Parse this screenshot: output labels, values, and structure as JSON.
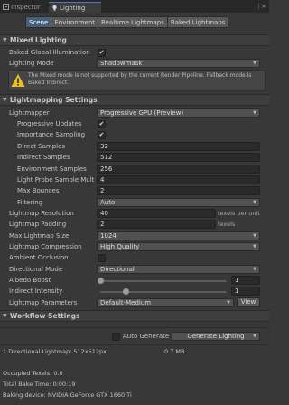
{
  "window_tabs": [
    {
      "label": "Inspector",
      "icon": "inspector-icon",
      "active": false
    },
    {
      "label": "Lighting",
      "icon": "lighting-icon",
      "active": true
    }
  ],
  "lighting_tabs": [
    "Scene",
    "Environment",
    "Realtime Lightmaps",
    "Baked Lightmaps"
  ],
  "sections": {
    "mixed": "Mixed Lighting",
    "lightmapping": "Lightmapping Settings",
    "workflow": "Workflow Settings"
  },
  "mixed": {
    "baked_gi_label": "Baked Global Illumination",
    "baked_gi_checked": true,
    "lighting_mode_label": "Lighting Mode",
    "lighting_mode_value": "Shadowmask",
    "warning_text": "The Mixed mode is not supported by the current Render Pipeline. Fallback mode is Baked Indirect."
  },
  "lightmapping": {
    "lightmapper_label": "Lightmapper",
    "lightmapper_value": "Progressive GPU (Preview)",
    "progressive_updates_label": "Progressive Updates",
    "progressive_updates_checked": true,
    "importance_sampling_label": "Importance Sampling",
    "importance_sampling_checked": true,
    "direct_samples_label": "Direct Samples",
    "direct_samples_value": "32",
    "indirect_samples_label": "Indirect Samples",
    "indirect_samples_value": "512",
    "environment_samples_label": "Environment Samples",
    "environment_samples_value": "256",
    "light_probe_label": "Light Probe Sample Multi",
    "light_probe_value": "4",
    "max_bounces_label": "Max Bounces",
    "max_bounces_value": "2",
    "filtering_label": "Filtering",
    "filtering_value": "Auto",
    "resolution_label": "Lightmap Resolution",
    "resolution_value": "40",
    "resolution_unit": "texels per unit",
    "padding_label": "Lightmap Padding",
    "padding_value": "2",
    "padding_unit": "texels",
    "max_size_label": "Max Lightmap Size",
    "max_size_value": "1024",
    "compression_label": "Lightmap Compression",
    "compression_value": "High Quality",
    "ambient_occlusion_label": "Ambient Occlusion",
    "ambient_occlusion_checked": false,
    "directional_mode_label": "Directional Mode",
    "directional_mode_value": "Directional",
    "albedo_boost_label": "Albedo Boost",
    "albedo_boost_value": "1",
    "albedo_boost_fraction": 0.0,
    "indirect_intensity_label": "Indirect Intensity",
    "indirect_intensity_value": "1",
    "indirect_intensity_fraction": 0.2,
    "parameters_label": "Lightmap Parameters",
    "parameters_value": "Default-Medium",
    "view_button": "View"
  },
  "workflow": {
    "auto_generate_label": "Auto Generate",
    "auto_generate_checked": false,
    "generate_button": "Generate Lighting"
  },
  "stats": {
    "lightmap_summary": "1 Directional Lightmap: 512x512px",
    "lightmap_size": "0.7 MB",
    "occupied_texels": "Occupied Texels: 0.0",
    "total_bake_time": "Total Bake Time: 0:00:19",
    "baking_device": "Baking device: NVIDIA GeForce GTX 1660 Ti"
  },
  "colors": {
    "panel_bg": "#383838",
    "accent_tab": "#46607c",
    "warning": "#e8c020"
  }
}
